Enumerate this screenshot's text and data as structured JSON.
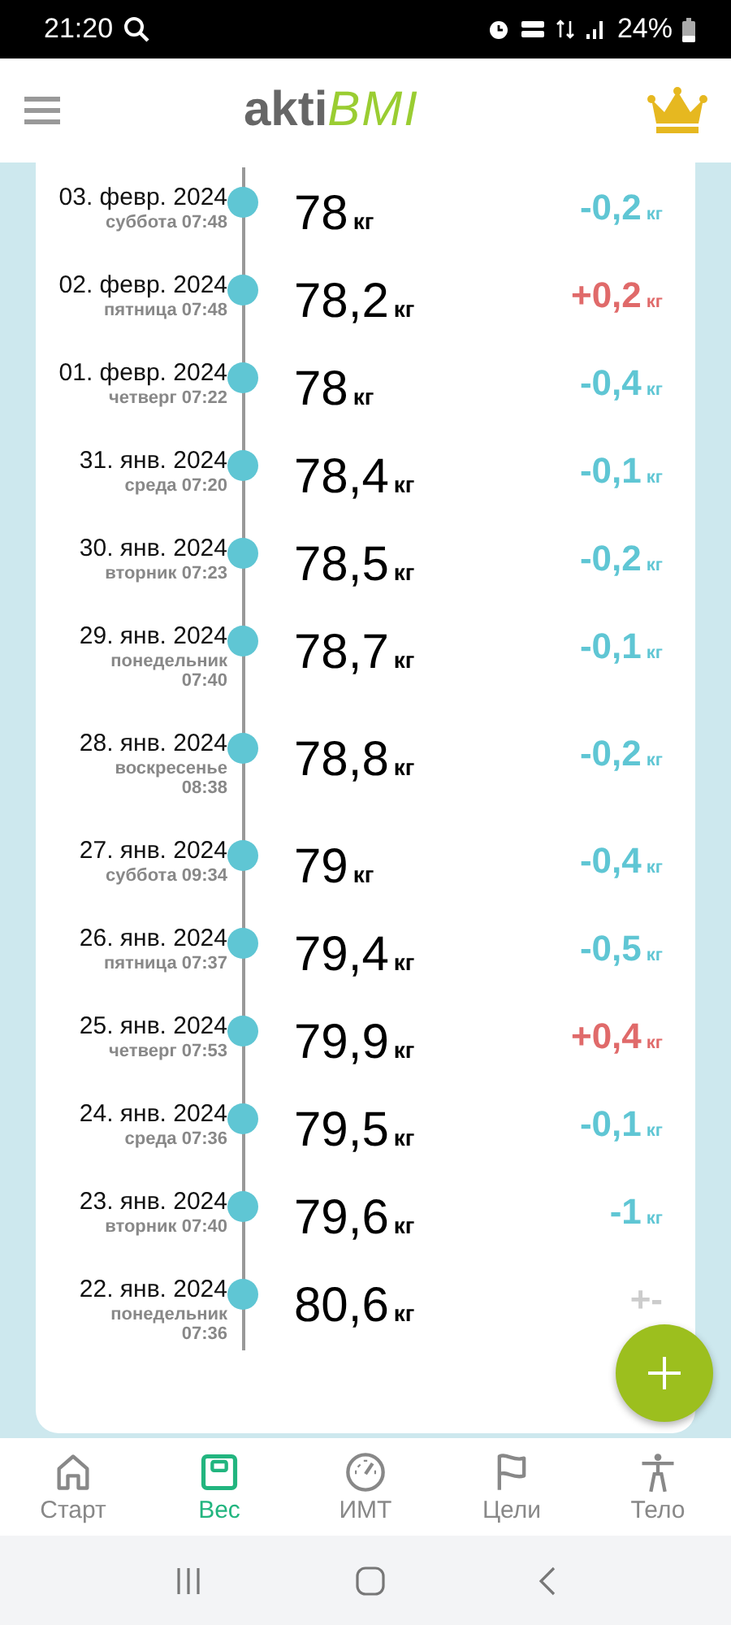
{
  "status_bar": {
    "time": "21:20",
    "battery": "24%"
  },
  "header": {
    "logo": {
      "part1": "akti",
      "part2": "BMI"
    }
  },
  "entries": [
    {
      "date": "03. февр. 2024",
      "day": "суббота 07:48",
      "weight": "78",
      "weight_unit": "кг",
      "change": "-0,2",
      "change_unit": "кг",
      "kind": "down"
    },
    {
      "date": "02. февр. 2024",
      "day": "пятница 07:48",
      "weight": "78,2",
      "weight_unit": "кг",
      "change": "+0,2",
      "change_unit": "кг",
      "kind": "up"
    },
    {
      "date": "01. февр. 2024",
      "day": "четверг 07:22",
      "weight": "78",
      "weight_unit": "кг",
      "change": "-0,4",
      "change_unit": "кг",
      "kind": "down"
    },
    {
      "date": "31. янв. 2024",
      "day": "среда 07:20",
      "weight": "78,4",
      "weight_unit": "кг",
      "change": "-0,1",
      "change_unit": "кг",
      "kind": "down"
    },
    {
      "date": "30. янв. 2024",
      "day": "вторник 07:23",
      "weight": "78,5",
      "weight_unit": "кг",
      "change": "-0,2",
      "change_unit": "кг",
      "kind": "down"
    },
    {
      "date": "29. янв. 2024",
      "day": "понедельник 07:40",
      "weight": "78,7",
      "weight_unit": "кг",
      "change": "-0,1",
      "change_unit": "кг",
      "kind": "down"
    },
    {
      "date": "28. янв. 2024",
      "day": "воскресенье 08:38",
      "weight": "78,8",
      "weight_unit": "кг",
      "change": "-0,2",
      "change_unit": "кг",
      "kind": "down"
    },
    {
      "date": "27. янв. 2024",
      "day": "суббота 09:34",
      "weight": "79",
      "weight_unit": "кг",
      "change": "-0,4",
      "change_unit": "кг",
      "kind": "down"
    },
    {
      "date": "26. янв. 2024",
      "day": "пятница 07:37",
      "weight": "79,4",
      "weight_unit": "кг",
      "change": "-0,5",
      "change_unit": "кг",
      "kind": "down"
    },
    {
      "date": "25. янв. 2024",
      "day": "четверг 07:53",
      "weight": "79,9",
      "weight_unit": "кг",
      "change": "+0,4",
      "change_unit": "кг",
      "kind": "up"
    },
    {
      "date": "24. янв. 2024",
      "day": "среда 07:36",
      "weight": "79,5",
      "weight_unit": "кг",
      "change": "-0,1",
      "change_unit": "кг",
      "kind": "down"
    },
    {
      "date": "23. янв. 2024",
      "day": "вторник 07:40",
      "weight": "79,6",
      "weight_unit": "кг",
      "change": "-1",
      "change_unit": "кг",
      "kind": "down"
    },
    {
      "date": "22. янв. 2024",
      "day": "понедельник 07:36",
      "weight": "80,6",
      "weight_unit": "кг",
      "change": "+-",
      "kind": "neutral"
    }
  ],
  "bottom_nav": [
    {
      "label": "Старт",
      "kind": "home",
      "selected": false
    },
    {
      "label": "Вес",
      "kind": "scale",
      "selected": true
    },
    {
      "label": "ИМТ",
      "kind": "gauge",
      "selected": false
    },
    {
      "label": "Цели",
      "kind": "flag",
      "selected": false
    },
    {
      "label": "Тело",
      "kind": "body",
      "selected": false
    }
  ]
}
